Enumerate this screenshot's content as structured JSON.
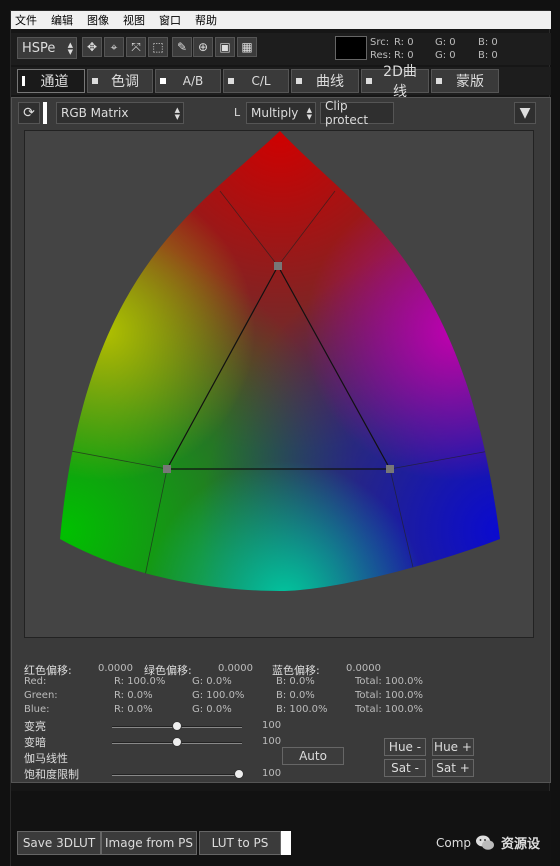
{
  "menu": [
    "文件",
    "编辑",
    "图像",
    "视图",
    "窗口",
    "帮助"
  ],
  "toolbar": {
    "mode": "HSPe",
    "src_label": "Src:",
    "res_label": "Res:",
    "src": {
      "r": "R:  0",
      "g": "G:  0",
      "b": "B:  0"
    },
    "res": {
      "r": "R:  0",
      "g": "G:  0",
      "b": "B:  0"
    }
  },
  "tabs": [
    "通道",
    "色调",
    "A/B",
    "C/L",
    "曲线",
    "2D曲线",
    "蒙版"
  ],
  "controls": {
    "matrix": "RGB Matrix",
    "l_label": "L",
    "blend": "Multiply",
    "clip": "Clip protect"
  },
  "offsets": {
    "red_label": "红色偏移:",
    "red_value": "0.0000",
    "green_label": "绿色偏移:",
    "green_value": "0.0000",
    "blue_label": "蓝色偏移:",
    "blue_value": "0.0000"
  },
  "matrix_rows": [
    {
      "name": "Red:",
      "r": "R: 100.0%",
      "g": "G: 0.0%",
      "b": "B: 0.0%",
      "total": "Total: 100.0%"
    },
    {
      "name": "Green:",
      "r": "R: 0.0%",
      "g": "G: 100.0%",
      "b": "B: 0.0%",
      "total": "Total: 100.0%"
    },
    {
      "name": "Blue:",
      "r": "R: 0.0%",
      "g": "G: 0.0%",
      "b": "B: 100.0%",
      "total": "Total: 100.0%"
    }
  ],
  "sliders": [
    {
      "label": "变亮",
      "value": "100",
      "level": 0.5
    },
    {
      "label": "变暗",
      "value": "100",
      "level": 0.5
    },
    {
      "label": "伽马线性",
      "value": "",
      "level": null
    },
    {
      "label": "饱和度限制",
      "value": "100",
      "level": 0.98
    }
  ],
  "buttons": {
    "auto": "Auto",
    "hue_minus": "Hue -",
    "hue_plus": "Hue +",
    "sat_minus": "Sat -",
    "sat_plus": "Sat +",
    "save_3dlut": "Save 3DLUT",
    "image_from_ps": "Image from PS",
    "lut_to_ps": "LUT to PS"
  },
  "footer": {
    "partial": "Comp",
    "brand": "资源设"
  }
}
